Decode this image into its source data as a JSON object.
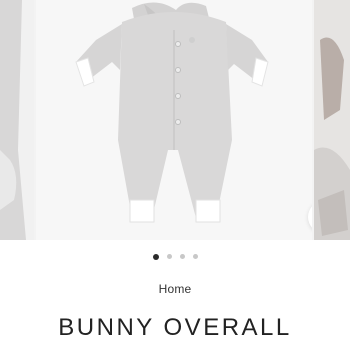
{
  "gallery": {
    "images": [
      {
        "name": "bunny-overall-detail-left"
      },
      {
        "name": "bunny-overall-front"
      },
      {
        "name": "bunny-overall-lifestyle-right"
      }
    ],
    "pagination": {
      "count": 4,
      "active_index": 0
    },
    "zoom_icon": "magnifier-icon"
  },
  "breadcrumb": {
    "label": "Home"
  },
  "product": {
    "title": "BUNNY OVERALL"
  },
  "colors": {
    "garment_grey": "#d9d8d8",
    "dot_active": "#2b2b2b",
    "dot_inactive": "#c8c8c8",
    "text": "#222222"
  }
}
